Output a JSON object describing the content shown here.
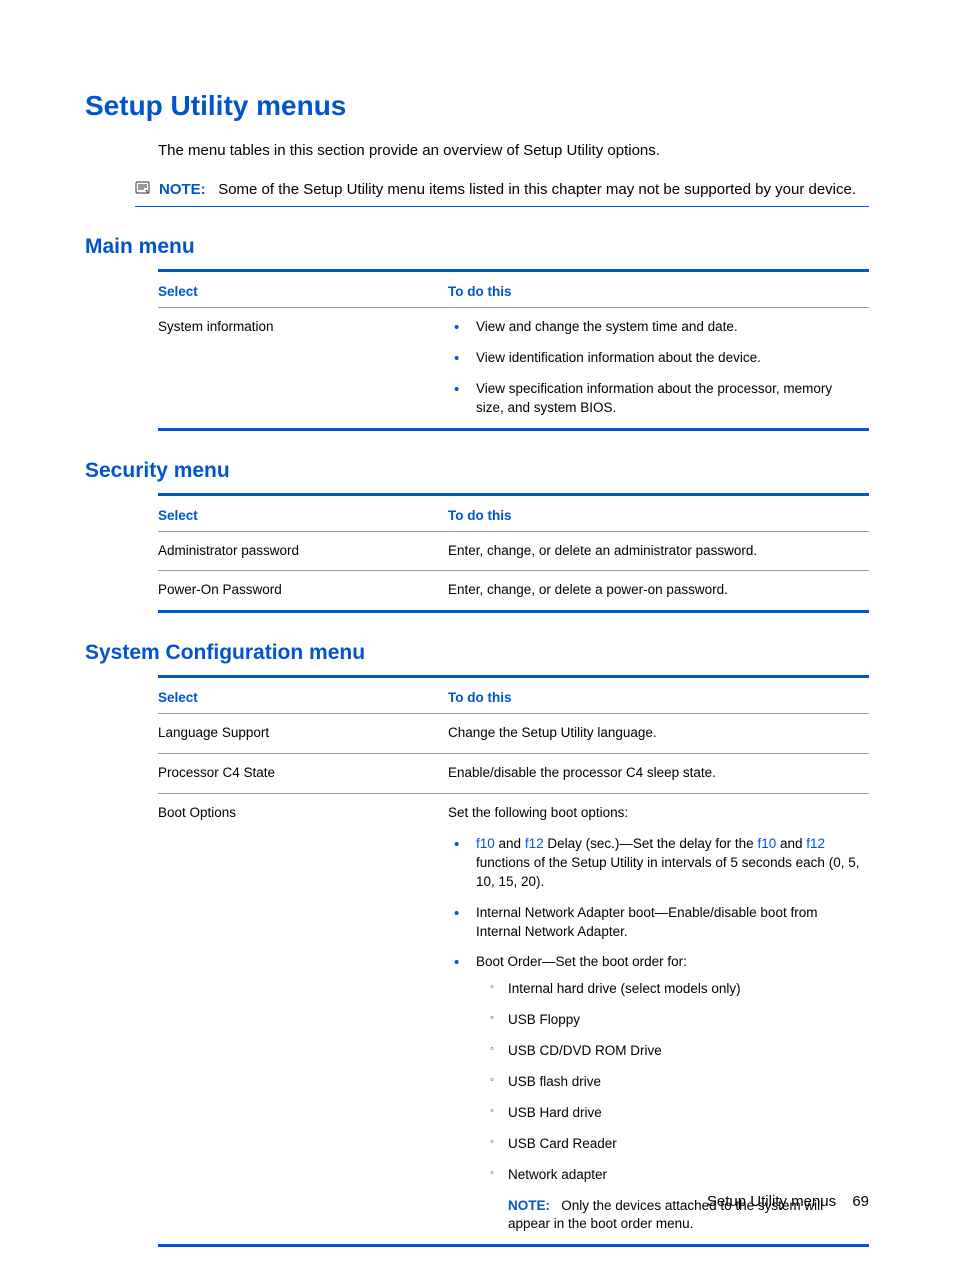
{
  "title": "Setup Utility menus",
  "intro": "The menu tables in this section provide an overview of Setup Utility options.",
  "top_note": {
    "label": "NOTE:",
    "text": "Some of the Setup Utility menu items listed in this chapter may not be supported by your device."
  },
  "sections": {
    "main": {
      "heading": "Main menu",
      "col_select": "Select",
      "col_todo": "To do this",
      "rows": {
        "sysinfo": {
          "select": "System information",
          "bullets": [
            "View and change the system time and date.",
            "View identification information about the device.",
            "View specification information about the processor, memory size, and system BIOS."
          ]
        }
      }
    },
    "security": {
      "heading": "Security menu",
      "col_select": "Select",
      "col_todo": "To do this",
      "rows": {
        "admin": {
          "select": "Administrator password",
          "desc": "Enter, change, or delete an administrator password."
        },
        "poweron": {
          "select": "Power-On Password",
          "desc": "Enter, change, or delete a power-on password."
        }
      }
    },
    "sysconfig": {
      "heading": "System Configuration menu",
      "col_select": "Select",
      "col_todo": "To do this",
      "rows": {
        "lang": {
          "select": "Language Support",
          "desc": "Change the Setup Utility language."
        },
        "c4": {
          "select": "Processor C4 State",
          "desc": "Enable/disable the processor C4 sleep state."
        },
        "boot": {
          "select": "Boot Options",
          "intro": "Set the following boot options:",
          "b1": {
            "f10a": "f10",
            "and1": " and ",
            "f12a": "f12",
            "mid": " Delay (sec.)—Set the delay for the ",
            "f10b": "f10",
            "and2": " and ",
            "f12b": "f12",
            "tail": " functions of the Setup Utility in intervals of 5 seconds each (0, 5, 10, 15, 20)."
          },
          "b2": "Internal Network Adapter boot—Enable/disable boot from Internal Network Adapter.",
          "b3": "Boot Order—Set the boot order for:",
          "sub": [
            "Internal hard drive (select models only)",
            "USB Floppy",
            "USB CD/DVD ROM Drive",
            "USB flash drive",
            "USB Hard drive",
            "USB Card Reader",
            "Network adapter"
          ],
          "subnote": {
            "label": "NOTE:",
            "text": "Only the devices attached to the system will appear in the boot order menu."
          }
        }
      }
    }
  },
  "footer": {
    "title": "Setup Utility menus",
    "page": "69"
  }
}
